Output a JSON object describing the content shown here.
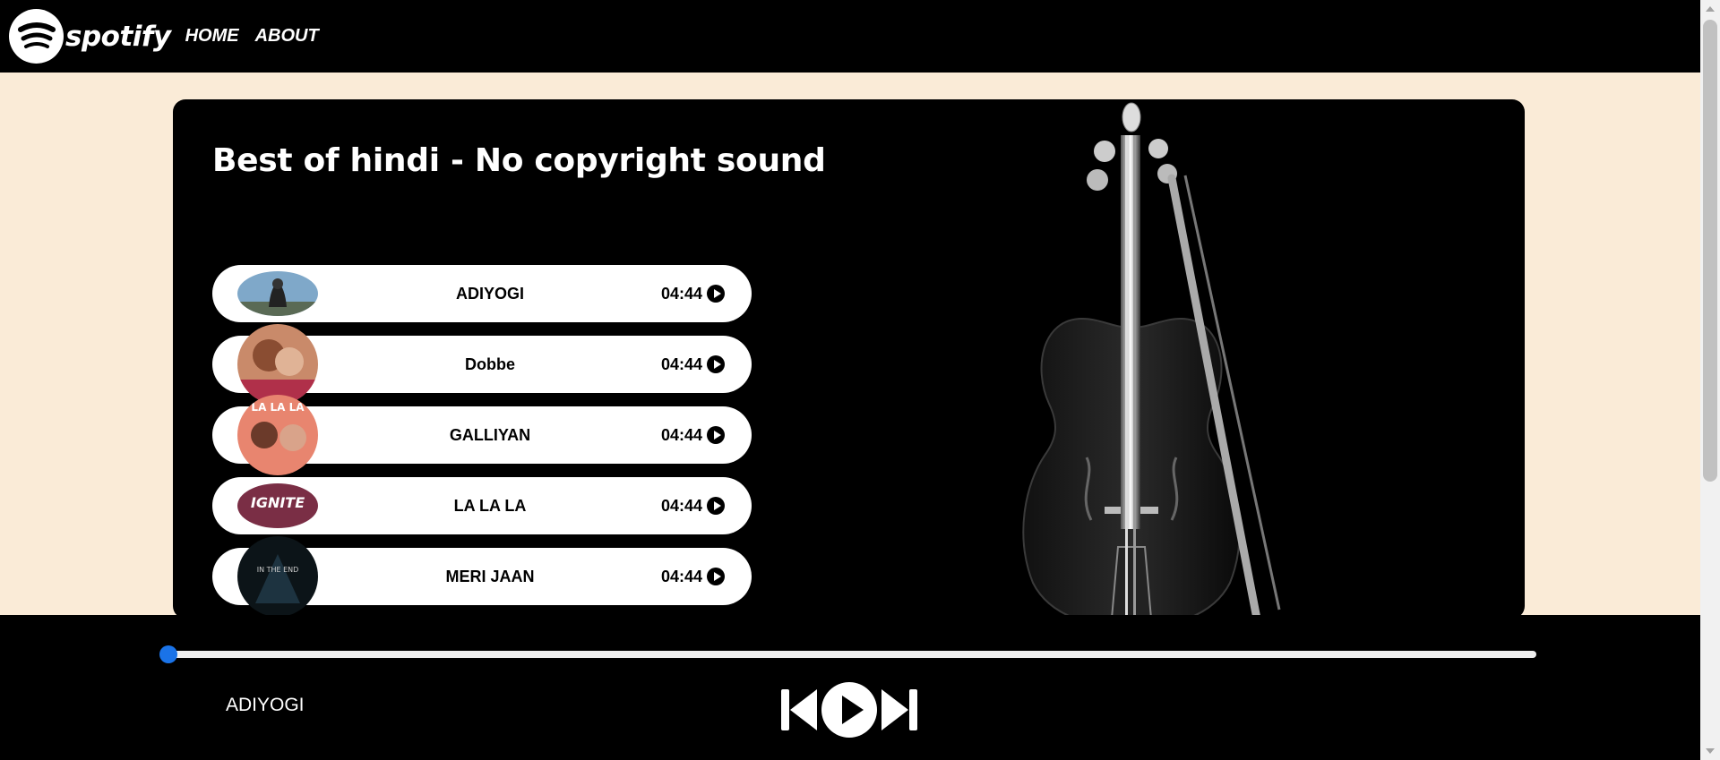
{
  "navbar": {
    "logo_text": "spotify",
    "links": [
      "HOME",
      "ABOUT"
    ]
  },
  "playlist": {
    "title": "Best of hindi - No copyright sound",
    "songs": [
      {
        "name": "ADIYOGI",
        "duration": "04:44",
        "thumb_text": ""
      },
      {
        "name": "Dobbe",
        "duration": "04:44",
        "thumb_text": ""
      },
      {
        "name": "GALLIYAN",
        "duration": "04:44",
        "thumb_text": "LA LA LA"
      },
      {
        "name": "LA LA LA",
        "duration": "04:44",
        "thumb_text": "IGNITE"
      },
      {
        "name": "MERI JAAN",
        "duration": "04:44",
        "thumb_text": "IN THE END"
      }
    ]
  },
  "player": {
    "current_song": "ADIYOGI",
    "progress": 0
  },
  "colors": {
    "background": "#faebd7",
    "bar": "#000000",
    "progress_thumb": "#1a73e8"
  }
}
